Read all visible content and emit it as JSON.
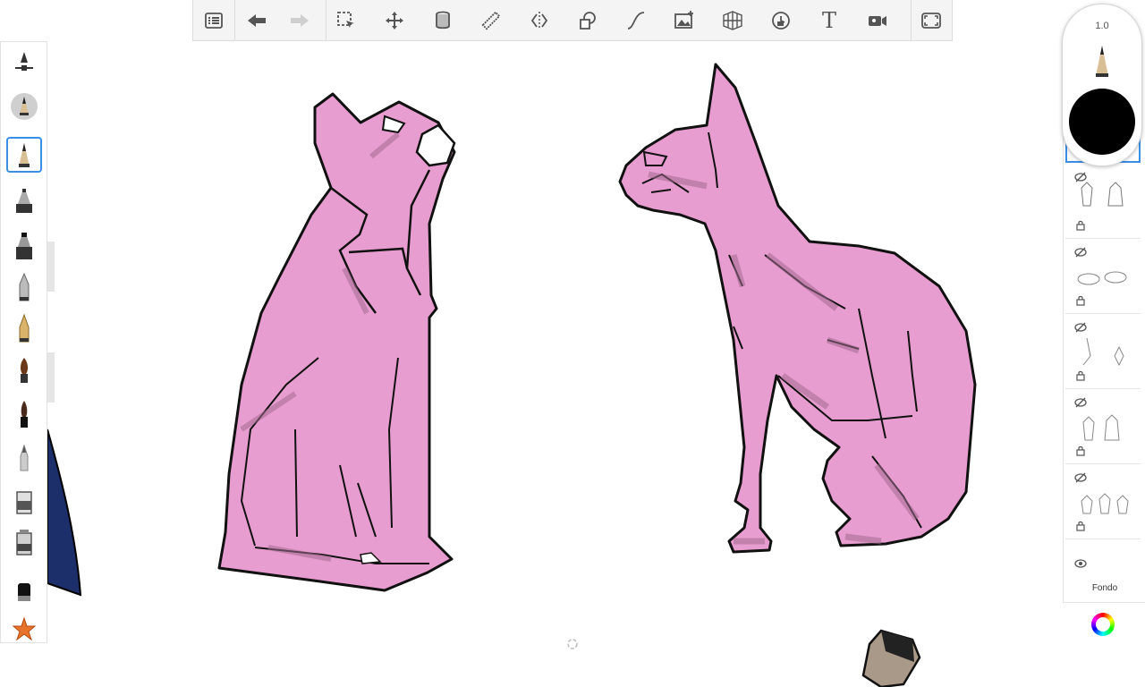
{
  "app": {
    "accent_color": "#3a8ee6"
  },
  "toolbar": {
    "items": [
      {
        "name": "layers-menu",
        "icon": "list-icon"
      },
      {
        "name": "undo",
        "icon": "undo-arrow-icon"
      },
      {
        "name": "redo",
        "icon": "redo-arrow-icon",
        "disabled": true
      },
      {
        "name": "selection",
        "icon": "selection-icon"
      },
      {
        "name": "transform",
        "icon": "move-icon"
      },
      {
        "name": "fill",
        "icon": "paint-bucket-icon"
      },
      {
        "name": "ruler",
        "icon": "ruler-icon"
      },
      {
        "name": "symmetry",
        "icon": "symmetry-icon"
      },
      {
        "name": "shapes",
        "icon": "shapes-icon"
      },
      {
        "name": "stroke",
        "icon": "curve-icon"
      },
      {
        "name": "image",
        "icon": "image-icon"
      },
      {
        "name": "perspective",
        "icon": "perspective-grid-icon"
      },
      {
        "name": "time-lapse",
        "icon": "timelapse-icon"
      },
      {
        "name": "text",
        "icon": "text-icon",
        "label": "T"
      },
      {
        "name": "video",
        "icon": "video-icon"
      },
      {
        "name": "fullscreen",
        "icon": "fullscreen-icon"
      }
    ]
  },
  "brush_panel": {
    "tools": [
      {
        "name": "brush-settings",
        "icon": "brush-settings-icon"
      },
      {
        "name": "current-brush",
        "icon": "pencil-round-icon"
      },
      {
        "name": "pencil",
        "icon": "pencil-icon",
        "selected": true
      },
      {
        "name": "airbrush",
        "icon": "airbrush-icon"
      },
      {
        "name": "marker-wide",
        "icon": "marker-icon"
      },
      {
        "name": "ballpoint",
        "icon": "ballpoint-icon"
      },
      {
        "name": "fountain-pen",
        "icon": "fountain-pen-icon"
      },
      {
        "name": "paint-brush",
        "icon": "paint-brush-icon"
      },
      {
        "name": "ink-brush",
        "icon": "ink-brush-icon"
      },
      {
        "name": "smudge",
        "icon": "smudge-icon"
      },
      {
        "name": "eraser-soft",
        "icon": "eraser-icon"
      },
      {
        "name": "eraser-hard",
        "icon": "eraser-hard-icon"
      },
      {
        "name": "solid-brush",
        "icon": "solid-brush-icon"
      },
      {
        "name": "favorites",
        "icon": "star-icon"
      }
    ]
  },
  "puck": {
    "brush_size": "1.0",
    "color": "#000000"
  },
  "layers": {
    "items": [
      {
        "name": "layer-1",
        "hidden": true
      },
      {
        "name": "layer-2",
        "hidden": true
      },
      {
        "name": "layer-3",
        "hidden": true
      },
      {
        "name": "layer-4",
        "hidden": true
      },
      {
        "name": "layer-5",
        "hidden": true
      }
    ],
    "background_label": "Fondo"
  },
  "drawing": {
    "cat_color": "#e89dd0",
    "shadow_color": "#a26a8f",
    "outline_color": "#111111"
  }
}
